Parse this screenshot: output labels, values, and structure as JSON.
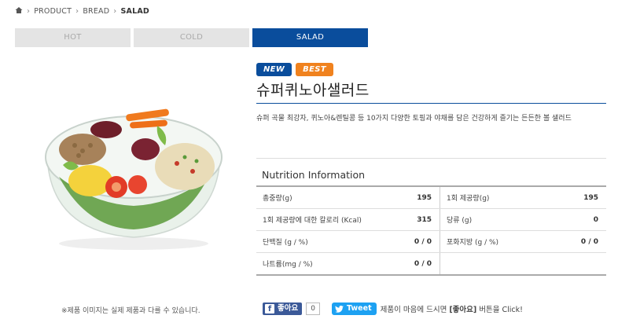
{
  "breadcrumb": {
    "home_icon": "home-icon",
    "items": [
      "PRODUCT",
      "BREAD",
      "SALAD"
    ]
  },
  "tabs": [
    {
      "label": "HOT",
      "active": false
    },
    {
      "label": "COLD",
      "active": false
    },
    {
      "label": "SALAD",
      "active": true
    }
  ],
  "product": {
    "badges": {
      "new": "NEW",
      "best": "BEST"
    },
    "name": "슈퍼퀴노아샐러드",
    "description": "슈퍼 곡물 최강자, 퀴노아&렌틸콩 등 10가지 다양한 토핑과 야채를 담은 건강하게 즐기는 든든한 볼 샐러드",
    "image_note": "※제품 이미지는 실제 제품과 다를 수 있습니다."
  },
  "nutrition": {
    "title": "Nutrition Information",
    "rows": [
      [
        {
          "label": "총중량(g)",
          "value": "195"
        },
        {
          "label": "1회 제공량(g)",
          "value": "195"
        }
      ],
      [
        {
          "label": "1회 제공량에 대한 칼로리 (Kcal)",
          "value": "315"
        },
        {
          "label": "당류 (g)",
          "value": "0"
        }
      ],
      [
        {
          "label": "단백질 (g / %)",
          "value": "0 / 0"
        },
        {
          "label": "포화지방 (g / %)",
          "value": "0 / 0"
        }
      ],
      [
        {
          "label": "나트륨(mg / %)",
          "value": "0 / 0"
        },
        {
          "label": "",
          "value": ""
        }
      ]
    ]
  },
  "social": {
    "like_label": "좋아요",
    "like_count": "0",
    "tweet_label": "Tweet",
    "message_pre": "제품이 마음에 드시면 ",
    "message_highlight": "[좋아요]",
    "message_post": " 버튼을 Click!"
  },
  "colors": {
    "accent": "#0a4d9c",
    "best": "#f0821e",
    "facebook": "#3b5998",
    "twitter": "#1da1f2"
  }
}
